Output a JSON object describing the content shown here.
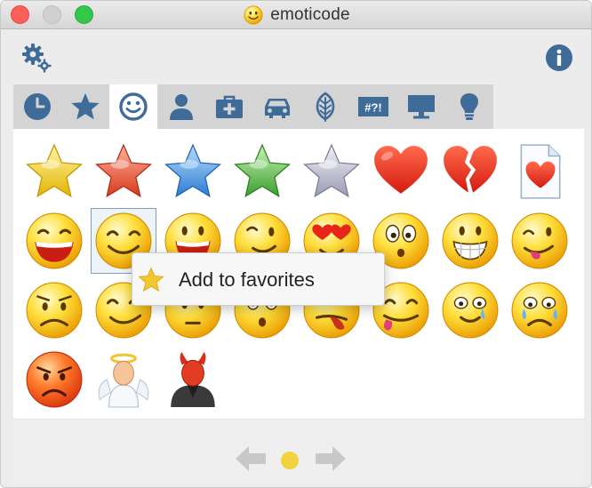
{
  "window": {
    "title": "emoticode",
    "title_icon": "smiley-icon"
  },
  "toolbar": {
    "settings_icon": "settings-gears-icon",
    "info_icon": "info-icon"
  },
  "tabs": [
    {
      "id": "recent",
      "icon": "clock-icon",
      "active": false
    },
    {
      "id": "favorites",
      "icon": "star-icon",
      "active": false
    },
    {
      "id": "smileys",
      "icon": "smiley-icon",
      "active": true
    },
    {
      "id": "people",
      "icon": "person-icon",
      "active": false
    },
    {
      "id": "objects",
      "icon": "medical-kit-icon",
      "active": false
    },
    {
      "id": "travel",
      "icon": "car-icon",
      "active": false
    },
    {
      "id": "nature",
      "icon": "leaf-icon",
      "active": false
    },
    {
      "id": "symbols",
      "icon": "symbols-text-icon",
      "label": "#?!",
      "active": false
    },
    {
      "id": "computer",
      "icon": "monitor-icon",
      "active": false
    },
    {
      "id": "ideas",
      "icon": "lightbulb-icon",
      "active": false
    }
  ],
  "emoticons": [
    [
      "gold-star",
      "red-star",
      "blue-star",
      "green-star",
      "silver-star",
      "red-heart",
      "broken-heart",
      "heart-document"
    ],
    [
      "laughing-face",
      "smiling-face",
      "grinning-face",
      "winking-face",
      "heart-eyes-face",
      "surprised-face",
      "big-grin-face",
      "tongue-out-face"
    ],
    [
      "worried-face",
      "smiling-face-2",
      "neutral-face",
      "shocked-face",
      "tongue-face",
      "silly-face",
      "tears-of-joy-face",
      "crying-face"
    ],
    [
      "angry-face",
      "angel",
      "devil"
    ]
  ],
  "selected_emoticon": "smiling-face",
  "context_menu": {
    "item_label": "Add to favorites",
    "item_icon": "favorite-star-icon"
  },
  "pagination": {
    "prev_icon": "arrow-left-icon",
    "next_icon": "arrow-right-icon",
    "current_page_icon": "page-dot-icon"
  },
  "colors": {
    "accent_blue": "#3f6b99",
    "emoticon_yellow": "#ffd633",
    "heart_red": "#e02a1a"
  }
}
